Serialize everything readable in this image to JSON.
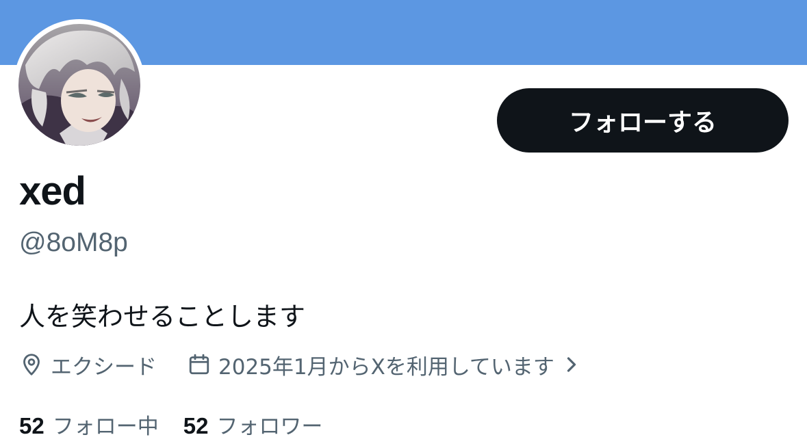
{
  "colors": {
    "banner": "#5c97e2",
    "primary_text": "#0f1419",
    "secondary_text": "#536471",
    "follow_button_bg": "#0f1419",
    "follow_button_text": "#ffffff"
  },
  "profile": {
    "display_name": "xed",
    "handle": "@8oM8p",
    "bio": "人を笑わせることします",
    "follow_button_label": "フォローする"
  },
  "meta": {
    "location_icon": "location-pin-icon",
    "location": "エクシード",
    "joined_icon": "calendar-icon",
    "joined": "2025年1月からXを利用しています",
    "joined_chevron_icon": "chevron-right-icon"
  },
  "stats": {
    "following_count": "52",
    "following_label": "フォロー中",
    "followers_count": "52",
    "followers_label": "フォロワー"
  }
}
